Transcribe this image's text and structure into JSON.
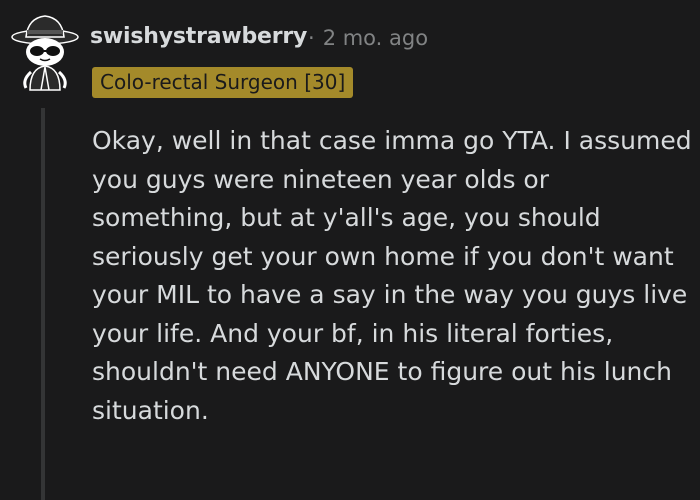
{
  "comment": {
    "username": "swishystrawberry",
    "separator": "·",
    "age": "2 mo. ago",
    "flair": "Colo-rectal Surgeon [30]",
    "body": "Okay, well in that case imma go YTA. I assumed you guys were nineteen year olds or something, but at y'all's age, you should seriously get your own home if you don't want your MIL to have a say in the way you guys live your life. And your bf, in his literal forties, shouldn't need ANYONE to figure out his lunch situation."
  },
  "colors": {
    "background": "#1a1a1b",
    "text": "#d7dadc",
    "meta": "#818384",
    "flair_bg": "#a48a2a",
    "thread_line": "#343536"
  },
  "icons": {
    "avatar": "snoo-avatar-fedora-sunglasses"
  }
}
